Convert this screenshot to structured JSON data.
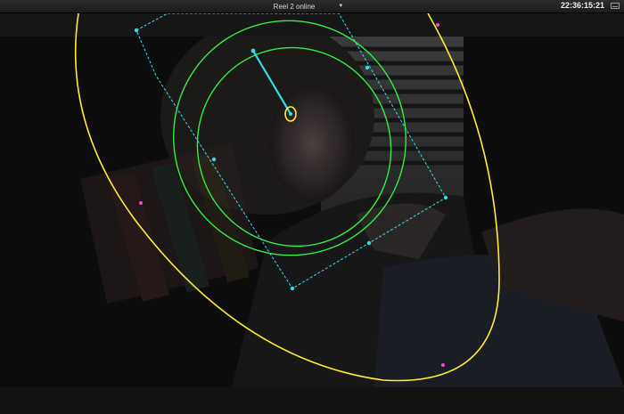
{
  "viewer": {
    "clip_name": "Reel 2 online",
    "timecode": "22:36:15:21"
  },
  "icons": {
    "dropdown": "chevron-down-icon",
    "viewer_mode": "monitor-icon"
  },
  "colors": {
    "power_window_yellow": "#ffee33",
    "power_window_green": "#33ee44",
    "tracker_cyan": "#33dde8",
    "handle_magenta": "#ff44cc"
  }
}
